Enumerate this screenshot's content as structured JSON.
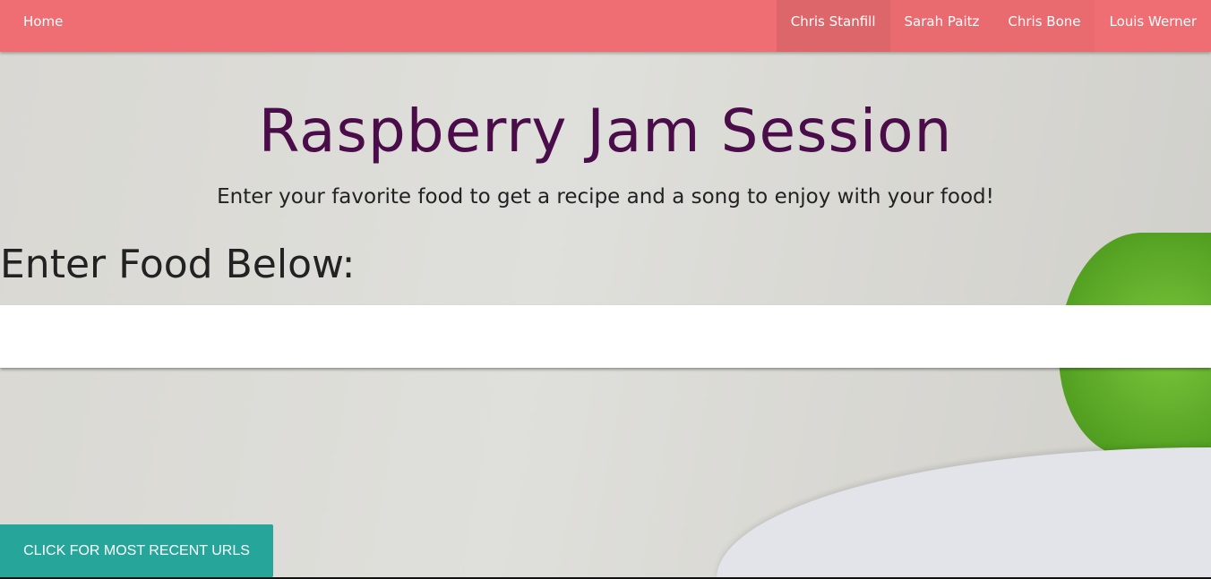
{
  "nav": {
    "home": "Home",
    "links": [
      "Chris Stanfill",
      "Sarah Paitz",
      "Chris Bone",
      "Louis Werner"
    ]
  },
  "header": {
    "title": "Raspberry Jam Session",
    "subtitle": "Enter your favorite food to get a recipe and a song to enjoy with your food!"
  },
  "form": {
    "label": "Enter Food Below:",
    "value": ""
  },
  "recent_button": "CLICK FOR MOST RECENT URLS",
  "colors": {
    "nav": "#ee6e73",
    "title": "#4a0d4a",
    "button": "#26a69a"
  }
}
